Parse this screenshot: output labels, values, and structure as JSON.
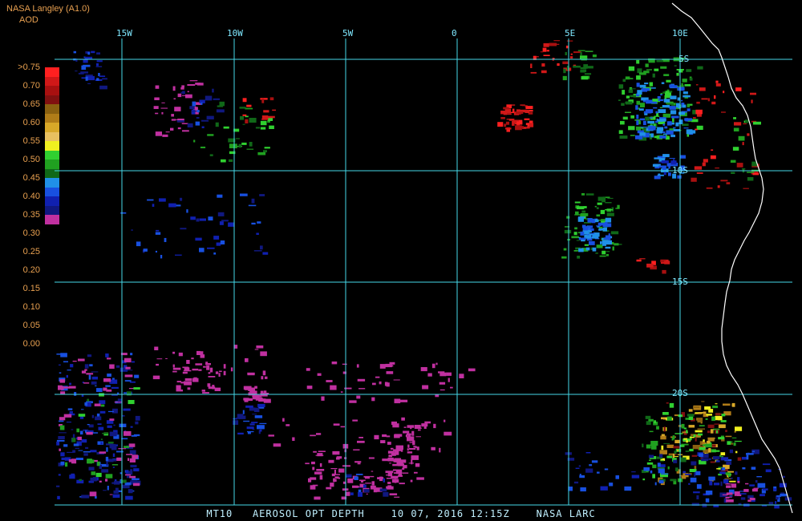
{
  "header": {
    "title": "NASA Langley (A1.0)",
    "product": "AOD"
  },
  "footer": {
    "channel": "MT10",
    "product_name": "AEROSOL OPT DEPTH",
    "datetime": "10 07, 2016 12:15Z",
    "credit": "NASA LARC"
  },
  "colorbar": {
    "labels": [
      ">0.75",
      "0.70",
      "0.65",
      "0.60",
      "0.55",
      "0.50",
      "0.45",
      "0.40",
      "0.35",
      "0.30",
      "0.25",
      "0.20",
      "0.15",
      "0.10",
      "0.05",
      "0.00"
    ],
    "colors": [
      "#ff2020",
      "#d01818",
      "#a81010",
      "#801010",
      "#8a6010",
      "#b07c18",
      "#d8a828",
      "#e8c060",
      "#f0f020",
      "#30d030",
      "#20a020",
      "#106818",
      "#2090e8",
      "#1850e0",
      "#1020b0",
      "#101880",
      "#c030a0"
    ]
  },
  "longitude_labels": [
    "15W",
    "10W",
    "5W",
    "0",
    "5E",
    "10E"
  ],
  "latitude_labels": [
    "5S",
    "10S",
    "15S",
    "20S"
  ],
  "colors": {
    "grid": "#46d8e8",
    "coast": "#ffffff",
    "label": "#7fe8ff",
    "title": "#e8a050"
  }
}
